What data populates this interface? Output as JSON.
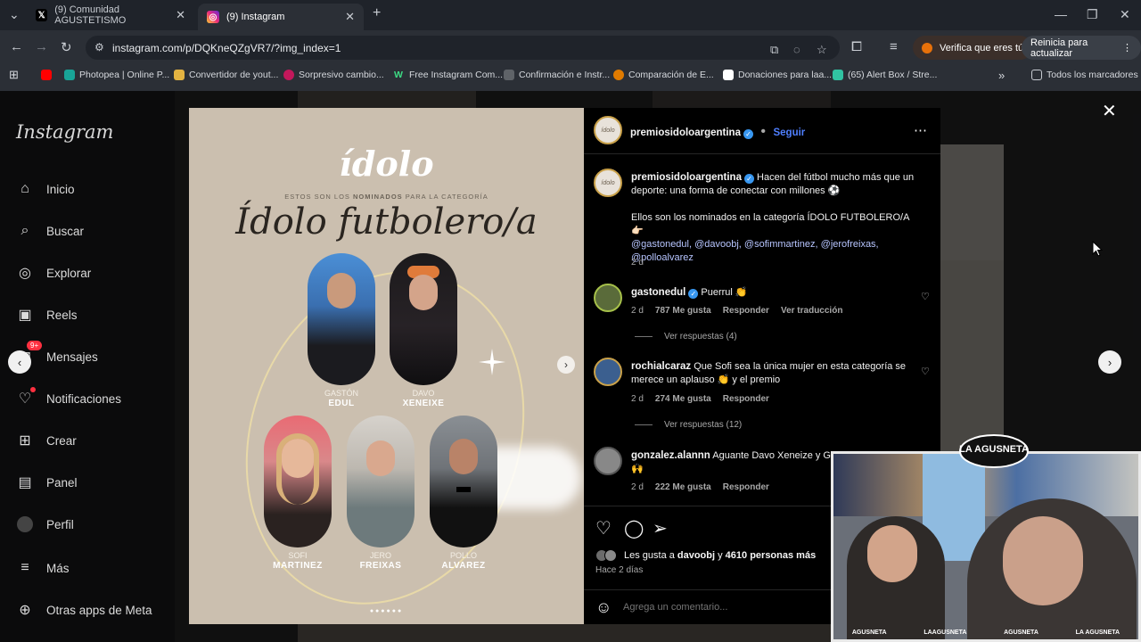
{
  "browser": {
    "tabs": [
      {
        "title": "(9) Comunidad AGUSTETISMO"
      },
      {
        "title": "(9) Instagram"
      }
    ],
    "url": "instagram.com/p/DQKneQZgVR7/?img_index=1",
    "verify_label": "Verifica que eres tú",
    "restart_label": "Reinicia para actualizar",
    "bookmarks": [
      "Photopea | Online P...",
      "Convertidor de yout...",
      "Sorpresivo cambio...",
      "Free Instagram Com...",
      "Confirmación e Instr...",
      "Comparación de E...",
      "Donaciones para laa...",
      "(65) Alert Box / Stre..."
    ],
    "all_bookmarks": "Todos los marcadores"
  },
  "sidebar": {
    "logo": "Instagram",
    "items": [
      {
        "label": "Inicio",
        "icon": "home-icon"
      },
      {
        "label": "Buscar",
        "icon": "search-icon"
      },
      {
        "label": "Explorar",
        "icon": "explore-icon"
      },
      {
        "label": "Reels",
        "icon": "reels-icon"
      },
      {
        "label": "Mensajes",
        "icon": "messenger-icon"
      },
      {
        "label": "Notificaciones",
        "icon": "heart-icon"
      },
      {
        "label": "Crear",
        "icon": "plus-icon"
      },
      {
        "label": "Panel",
        "icon": "panel-icon"
      },
      {
        "label": "Perfil",
        "icon": "profile-icon"
      },
      {
        "label": "Más",
        "icon": "menu-icon"
      },
      {
        "label": "Otras apps de Meta",
        "icon": "meta-icon"
      }
    ],
    "messages_badge": "9+"
  },
  "post_image": {
    "brand": "ídolo",
    "subtitle_pre": "ESTOS SON LOS ",
    "subtitle_bold": "NOMINADOS",
    "subtitle_post": " PARA LA CATEGORÍA",
    "category": "Ídolo futbolero/a",
    "people": [
      {
        "first": "GASTÓN",
        "last": "EDUL"
      },
      {
        "first": "DAVO",
        "last": "XENEIXE"
      },
      {
        "first": "SOFI",
        "last": "MARTINEZ"
      },
      {
        "first": "JERO",
        "last": "FREIXAS"
      },
      {
        "first": "POLLO",
        "last": "ALVAREZ"
      }
    ],
    "dots": "●●●●●●"
  },
  "post": {
    "author": "premiosidoloargentina",
    "follow": "Seguir",
    "caption_line1": "Hacen del fútbol mucho más que un deporte: una forma de conectar con millones ⚽",
    "caption_line2": "Ellos son los nominados en la categoría ÍDOLO FUTBOLERO/A 👉🏻",
    "caption_mentions": "@gastonedul, @davoobj, @sofimmartinez, @jerofreixas, @polloalvarez",
    "caption_time": "2 d",
    "comments": [
      {
        "user": "gastonedul",
        "text": "Puerrul 👏",
        "time": "2 d",
        "likes": "787 Me gusta",
        "reply": "Responder",
        "translate": "Ver traducción",
        "replies": "Ver respuestas (4)"
      },
      {
        "user": "rochialcaraz",
        "text": "Que Sofi sea la única mujer en esta categoría se merece un aplauso 👏 y el premio",
        "time": "2 d",
        "likes": "274 Me gusta",
        "reply": "Responder",
        "replies": "Ver respuestas (12)"
      },
      {
        "user": "gonzalez.alannn",
        "text": "Aguante Davo Xeneize y Gas",
        "emoji": "🙌",
        "time": "2 d",
        "likes": "222 Me gusta",
        "reply": "Responder"
      }
    ],
    "likes_pre": "Les gusta a ",
    "likes_user": "davoobj",
    "likes_mid": " y ",
    "likes_count": "4610 personas más",
    "posted": "Hace 2 días",
    "add_comment_placeholder": "Agrega un comentario..."
  },
  "webcam": {
    "logo": "LA AGUSNETA",
    "footer": [
      "AGUSNETA",
      "LAAGUSNETA",
      "AGUSNETA",
      "LA AGUSNETA"
    ]
  },
  "colors": {
    "accent": "#4f7fff",
    "post_bg": "#cbbfaf",
    "panel_bg": "#000000",
    "browser_bg": "#2b2f36"
  }
}
